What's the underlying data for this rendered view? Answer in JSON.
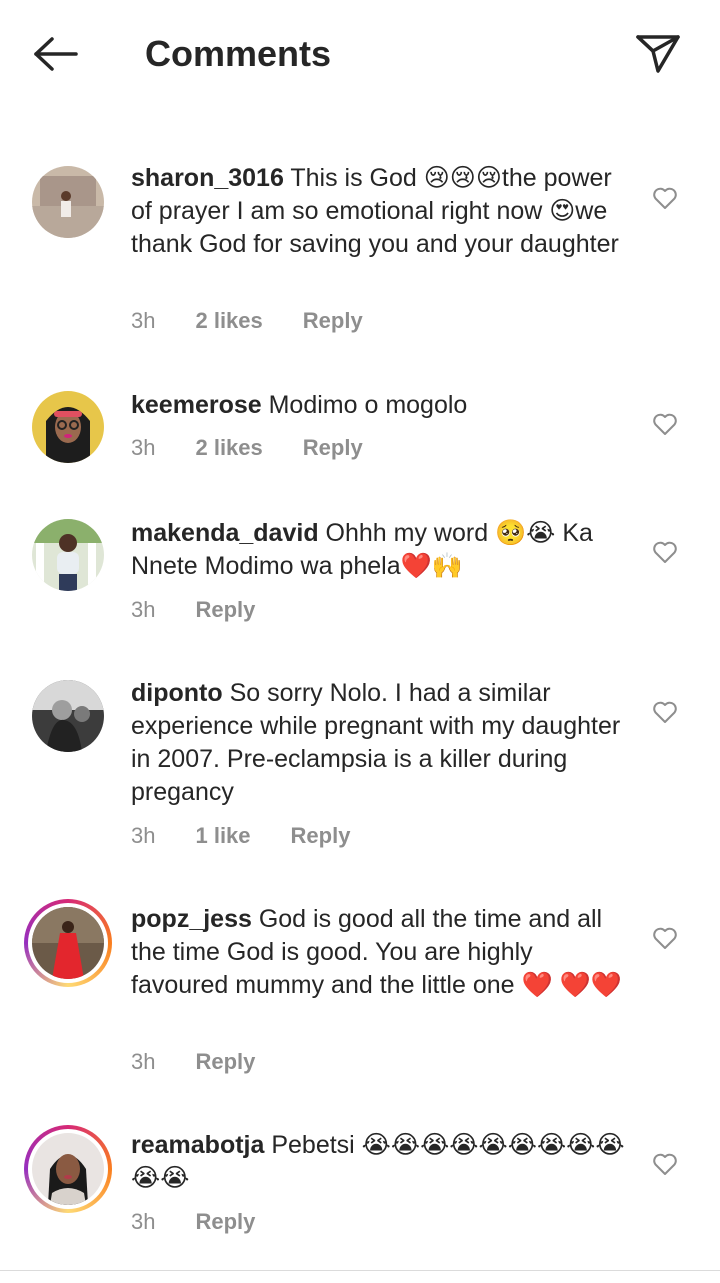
{
  "header": {
    "title": "Comments",
    "back_icon": "arrow-left-icon",
    "send_icon": "paper-plane-icon"
  },
  "comments": [
    {
      "username": "sharon_3016",
      "text": "This is God 😢😢😢the power of prayer I am so emotional right now 😍we thank God for saving you and your daughter",
      "time": "3h",
      "likes": "2 likes",
      "reply": "Reply"
    },
    {
      "username": "keemerose",
      "text": "Modimo o mogolo",
      "time": "3h",
      "likes": "2 likes",
      "reply": "Reply"
    },
    {
      "username": "makenda_david",
      "text": "Ohhh my word 🥺😭 Ka Nnete Modimo wa phela❤️🙌",
      "time": "3h",
      "likes": "",
      "reply": "Reply"
    },
    {
      "username": "diponto",
      "text": "So sorry Nolo. I had a similar experience while pregnant with my daughter in 2007. Pre-eclampsia is a killer during pregancy",
      "time": "3h",
      "likes": "1 like",
      "reply": "Reply"
    },
    {
      "username": "popz_jess",
      "text": "God is good all the time and all the time God is good. You are highly favoured mummy and the little one ❤️ ❤️❤️",
      "time": "3h",
      "likes": "",
      "reply": "Reply"
    },
    {
      "username": "reamabotja",
      "text": "Pebetsi 😭😭😭😭😭😭😭😭😭😭😭",
      "time": "3h",
      "likes": "",
      "reply": "Reply"
    }
  ],
  "colors": {
    "text": "#262626",
    "meta": "#8e8e8e",
    "heart_outline": "#8e8e8e"
  }
}
